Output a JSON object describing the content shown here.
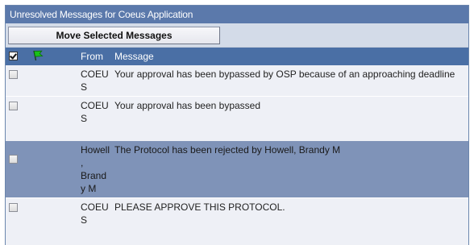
{
  "panel": {
    "title": "Unresolved Messages for Coeus Application"
  },
  "toolbar": {
    "move_label": "Move Selected Messages"
  },
  "table": {
    "columns": {
      "from": "From",
      "message": "Message"
    },
    "rows": [
      {
        "from": "COEUS",
        "message": "Your approval has been bypassed by OSP because of an approaching deadline",
        "checked": false
      },
      {
        "from": "COEUS",
        "message": "Your approval has been bypassed",
        "checked": false
      },
      {
        "from": "Howell, Brandy M",
        "message": "The Protocol has been rejected by Howell, Brandy M",
        "checked": false
      },
      {
        "from": "COEUS",
        "message": "PLEASE APPROVE THIS PROTOCOL.",
        "checked": false
      }
    ]
  },
  "colors": {
    "title_bar": "#5b79ab",
    "header_row": "#4a6fa5",
    "row_light": "#eef0f6",
    "row_dark": "#7f93b8",
    "flag": "#19c219"
  },
  "icons": {
    "select_all": "checkbox-checked-icon",
    "flag": "green-flag-icon"
  }
}
